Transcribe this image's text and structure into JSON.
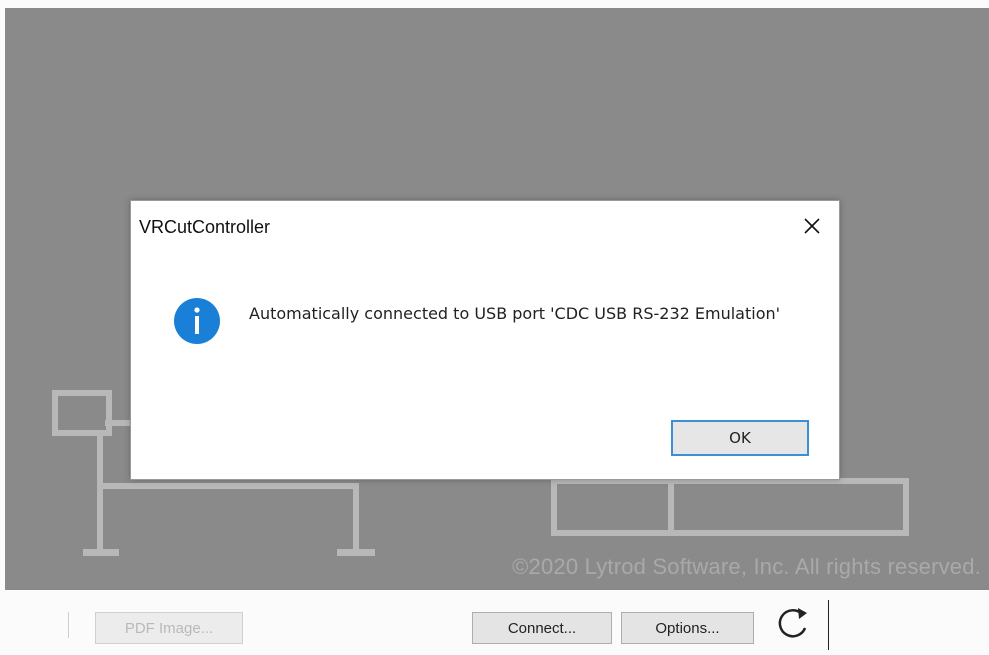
{
  "canvas": {
    "copyright": "©2020 Lytrod Software, Inc. All rights reserved."
  },
  "toolbar": {
    "pdf_image_label": "PDF Image...",
    "connect_label": "Connect...",
    "options_label": "Options...",
    "refresh_icon": "refresh-icon"
  },
  "dialog": {
    "title": "VRCutController",
    "message": "Automatically connected to USB port 'CDC USB RS-232 Emulation'",
    "ok_label": "OK",
    "icon": "info-icon",
    "close_icon": "close-icon"
  },
  "colors": {
    "canvas_bg": "#8a8a8a",
    "shape_color": "#b8b8b8",
    "info_blue": "#1a7fd6",
    "ok_border": "#3c8fd6"
  }
}
